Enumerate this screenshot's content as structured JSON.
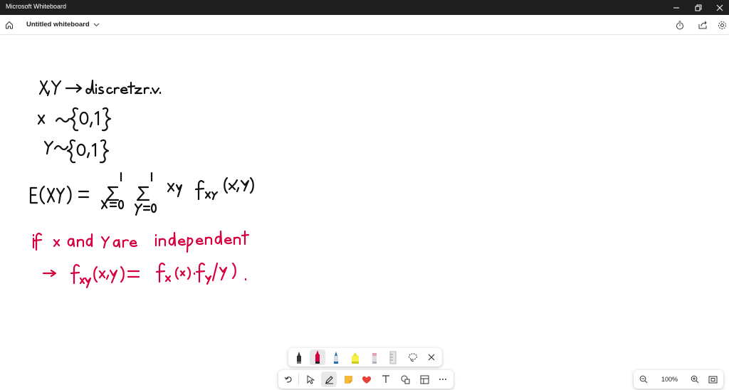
{
  "window": {
    "title": "Microsoft Whiteboard"
  },
  "appbar": {
    "board_title": "Untitled whiteboard"
  },
  "zoom": {
    "level": "100%"
  },
  "colors": {
    "accent_ink": "#d6003f",
    "black_ink": "#111111"
  },
  "icons": {
    "appbar": [
      "home-icon",
      "chevron-down-icon",
      "timer-icon",
      "share-icon",
      "settings-icon"
    ],
    "pen_tray": [
      "black-pen-icon",
      "red-pen-icon",
      "blue-pen-icon",
      "yellow-highlighter-icon",
      "pink-pen-icon",
      "ruler-icon",
      "lasso-icon",
      "close-icon"
    ],
    "toolbar": [
      "undo-icon",
      "select-icon",
      "pen-icon",
      "sticky-note-icon",
      "reactions-icon",
      "text-icon",
      "shapes-icon",
      "templates-icon",
      "more-icon"
    ],
    "zoombar": [
      "zoom-out-icon",
      "zoom-in-icon",
      "fit-screen-icon"
    ]
  }
}
